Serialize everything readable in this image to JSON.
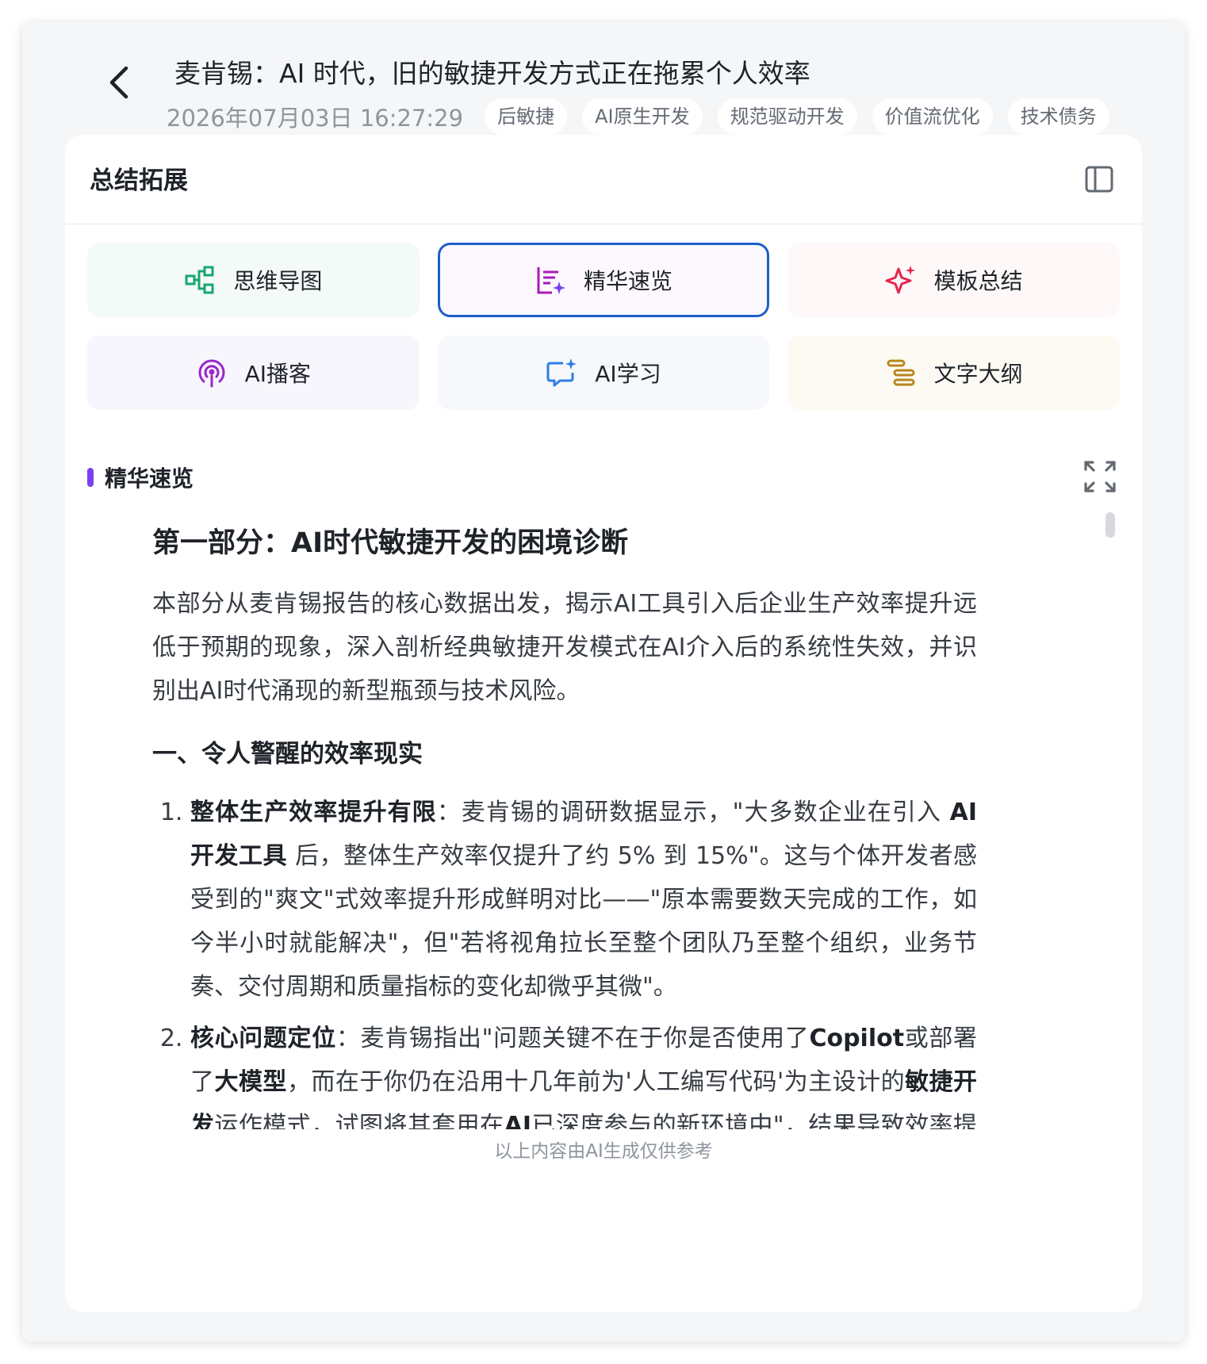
{
  "header": {
    "title": "麦肯锡：AI 时代，旧的敏捷开发方式正在拖累个人效率",
    "timestamp": "2026年07月03日 16:27:29",
    "tags": [
      "后敏捷",
      "AI原生开发",
      "规范驱动开发",
      "价值流优化",
      "技术债务"
    ],
    "back_icon": "chevron-left-icon"
  },
  "panel": {
    "title": "总结拓展",
    "toggle_icon": "sidebar-panel-icon",
    "features": [
      {
        "label": "思维导图",
        "icon": "mind-map-icon",
        "color": "#1aa672",
        "bg": "#f3faf7",
        "active": false
      },
      {
        "label": "精华速览",
        "icon": "highlights-list-icon",
        "color": "#a61cb8",
        "bg": "#fdf8fe",
        "active": true
      },
      {
        "label": "模板总结",
        "icon": "sparkle-icon",
        "color": "#e3264e",
        "bg": "#fef8f8",
        "active": false
      },
      {
        "label": "AI播客",
        "icon": "podcast-icon",
        "color": "#9b25c9",
        "bg": "#f7f6fd",
        "active": false
      },
      {
        "label": "AI学习",
        "icon": "chat-sparkle-icon",
        "color": "#2f7de8",
        "bg": "#f6f8fc",
        "active": false
      },
      {
        "label": "文字大纲",
        "icon": "outline-icon",
        "color": "#b8861b",
        "bg": "#fdfaf4",
        "active": false
      }
    ]
  },
  "section": {
    "label": "精华速览",
    "accent": "#7b3ff2",
    "expand_icon": "expand-icon"
  },
  "content": {
    "heading": "第一部分：AI时代敏捷开发的困境诊断",
    "intro": "本部分从麦肯锡报告的核心数据出发，揭示AI工具引入后企业生产效率提升远低于预期的现象，深入剖析经典敏捷开发模式在AI介入后的系统性失效，并识别出AI时代涌现的新型瓶颈与技术风险。",
    "subheading": "一、令人警醒的效率现实",
    "items": [
      {
        "bold": "整体生产效率提升有限",
        "p1": "：麦肯锡的调研数据显示，\"大多数企业在引入 ",
        "b2": "AI 开发工具",
        "p2": " 后，整体生产效率仅提升了约 5% 到 15%\"。这与个体开发者感受到的\"爽文\"式效率提升形成鲜明对比——\"原本需要数天完成的工作，如今半小时就能解决\"，但\"若将视角拉长至整个团队乃至整个组织，业务节奏、交付周期和质量指标的变化却微乎其微\"。"
      },
      {
        "bold": "核心问题定位",
        "p1": "：麦肯锡指出\"问题关键不在于你是否使用了",
        "b2": "Copilot",
        "p2": "或部署了",
        "b3": "大模型",
        "p3": "，而在于你仍在沿用十几年前为'人工编写代码'为主设计的",
        "b4": "敏捷开发",
        "p4": "运作模式，试图将其套用在",
        "b5": "AI",
        "p5": "已深度参与的新环境中\"，结果导致效率提升被流程瓶颈所抵消。"
      }
    ],
    "disclaimer": "以上内容由AI生成仅供参考"
  }
}
